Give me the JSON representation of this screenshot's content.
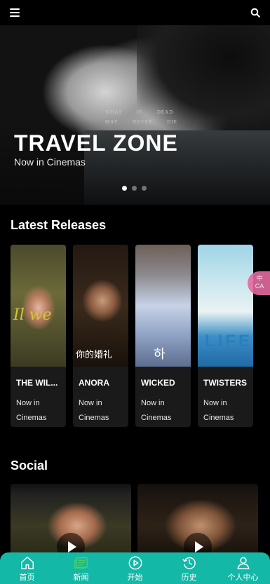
{
  "header": {
    "menu_icon": "hamburger-menu-icon",
    "search_icon": "search-icon"
  },
  "hero": {
    "title": "TRAVEL ZONE",
    "subtitle": "Now in Cinemas",
    "overlay_text": "WHAT IS DEAD MAY NEVER DIE",
    "slide_count": 3,
    "active_slide": 1
  },
  "releases": {
    "heading": "Latest Releases",
    "items": [
      {
        "title": "THE WIL...",
        "status": "Now in Cinemas",
        "poster_text": "Il we"
      },
      {
        "title": "ANORA",
        "status": "Now in Cinemas",
        "poster_text": "你的婚礼"
      },
      {
        "title": "WICKED",
        "status": "Now in Cinemas",
        "poster_text": "하"
      },
      {
        "title": "TWISTERS",
        "status": "Now in Cinemas",
        "poster_text": "LIFE"
      }
    ]
  },
  "social": {
    "heading": "Social"
  },
  "language_toggle": {
    "label": "中 CA",
    "color": "#e46aa0"
  },
  "tabbar": {
    "accent": "#14b8a6",
    "tabs": [
      {
        "label": "首页",
        "icon": "home-icon"
      },
      {
        "label": "新闻",
        "icon": "news-icon"
      },
      {
        "label": "开始",
        "icon": "play-circle-icon"
      },
      {
        "label": "历史",
        "icon": "history-icon"
      },
      {
        "label": "个人中心",
        "icon": "user-icon"
      }
    ]
  }
}
